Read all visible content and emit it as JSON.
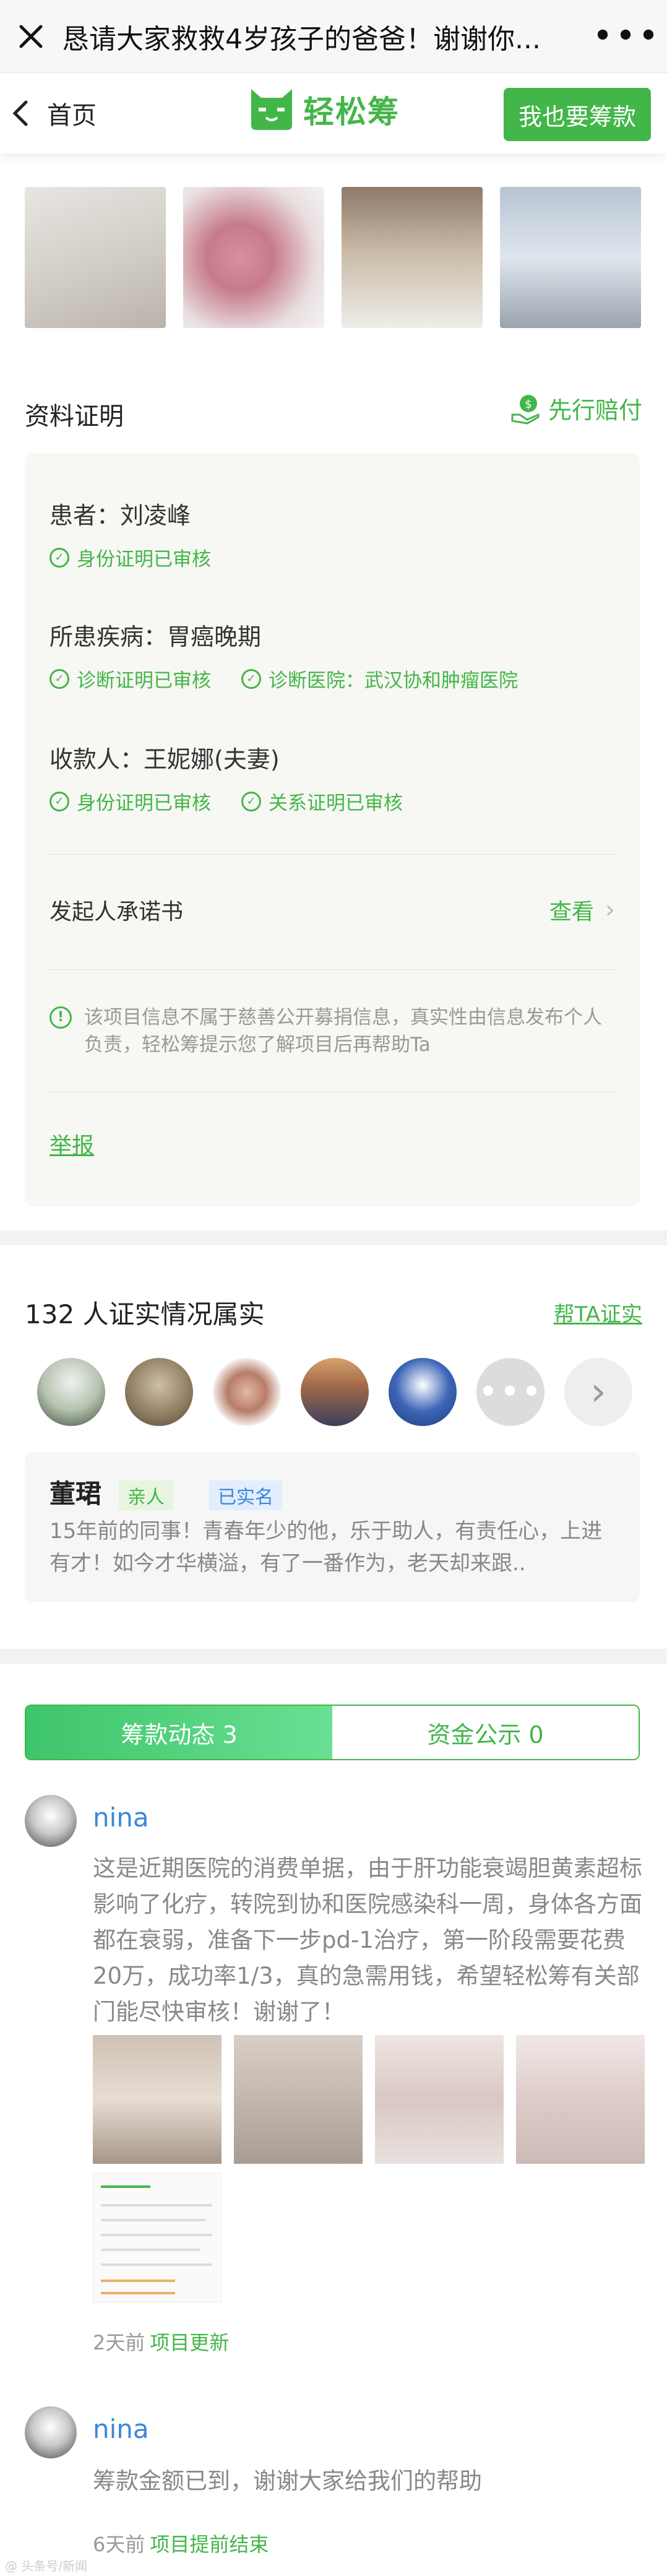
{
  "title_bar": {
    "title": "恳请大家救救4岁孩子的爸爸！谢谢你...",
    "more": "•••"
  },
  "nav": {
    "back_label": "首页",
    "brand": "轻松筹",
    "cta": "我也要筹款"
  },
  "materials": {
    "title": "资料证明",
    "guarantee": "先行赔付",
    "patient": "患者：刘凌峰",
    "patient_tag": "身份证明已审核",
    "disease": "所患疾病：胃癌晚期",
    "disease_tag1": "诊断证明已审核",
    "disease_tag2": "诊断医院：武汉协和肿瘤医院",
    "payee": "收款人：王妮娜(夫妻)",
    "payee_tag1": "身份证明已审核",
    "payee_tag2": "关系证明已审核",
    "promise": "发起人承诺书",
    "view": "查看",
    "notice": "该项目信息不属于慈善公开募捐信息，真实性由信息发布个人负责，轻松筹提示您了解项目后再帮助Ta",
    "report": "举报"
  },
  "verify": {
    "count": "132 人证实情况属实",
    "link": "帮TA证实",
    "more_icon": "•••",
    "next_icon": "›",
    "quote": {
      "name": "董珺",
      "badge1": "亲人",
      "badge2": "已实名",
      "text": "15年前的同事！青春年少的他，乐于助人，有责任心，上进有才！如今才华横溢，有了一番作为，老天却来跟.."
    }
  },
  "tabs": {
    "active": "筹款动态 3",
    "inactive": "资金公示 0"
  },
  "updates": [
    {
      "name": "nina",
      "text": "这是近期医院的消费单据，由于肝功能衰竭胆黄素超标影响了化疗，转院到协和医院感染科一周，身体各方面都在衰弱，准备下一步pd-1治疗，第一阶段需要花费20万，成功率1/3，真的急需用钱，希望轻松筹有关部门能尽快审核！谢谢了！",
      "time": "2天前",
      "status": "项目更新"
    },
    {
      "name": "nina",
      "text": "筹款金额已到，谢谢大家给我们的帮助",
      "time": "6天前",
      "status": "项目提前结束"
    }
  ],
  "watermark": "@ 头条号/新闻"
}
